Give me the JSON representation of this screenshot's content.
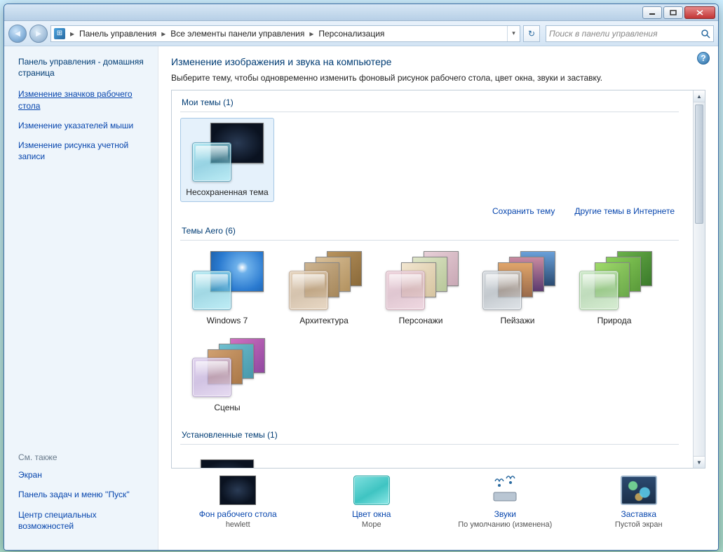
{
  "breadcrumb": {
    "seg1": "Панель управления",
    "seg2": "Все элементы панели управления",
    "seg3": "Персонализация"
  },
  "search": {
    "placeholder": "Поиск в панели управления"
  },
  "sidebar": {
    "home": "Панель управления - домашняя страница",
    "links": [
      "Изменение значков рабочего стола",
      "Изменение указателей мыши",
      "Изменение рисунка учетной записи"
    ],
    "see_also_label": "См. также",
    "see_also": [
      "Экран",
      "Панель задач и меню ''Пуск''",
      "Центр специальных возможностей"
    ]
  },
  "main": {
    "title": "Изменение изображения и звука на компьютере",
    "desc": "Выберите тему, чтобы одновременно изменить фоновый рисунок рабочего стола, цвет окна, звуки и заставку.",
    "groups": {
      "my": "Мои темы (1)",
      "aero": "Темы Aero (6)",
      "installed": "Установленные темы (1)"
    },
    "my_theme": "Несохраненная тема",
    "aero_themes": [
      "Windows 7",
      "Архитектура",
      "Персонажи",
      "Пейзажи",
      "Природа",
      "Сцены"
    ],
    "actions": {
      "save": "Сохранить тему",
      "more": "Другие темы в Интернете"
    }
  },
  "settings": {
    "bg": {
      "title": "Фон рабочего стола",
      "value": "hewlett"
    },
    "color": {
      "title": "Цвет окна",
      "value": "Море"
    },
    "sound": {
      "title": "Звуки",
      "value": "По умолчанию (изменена)"
    },
    "saver": {
      "title": "Заставка",
      "value": "Пустой экран"
    }
  }
}
